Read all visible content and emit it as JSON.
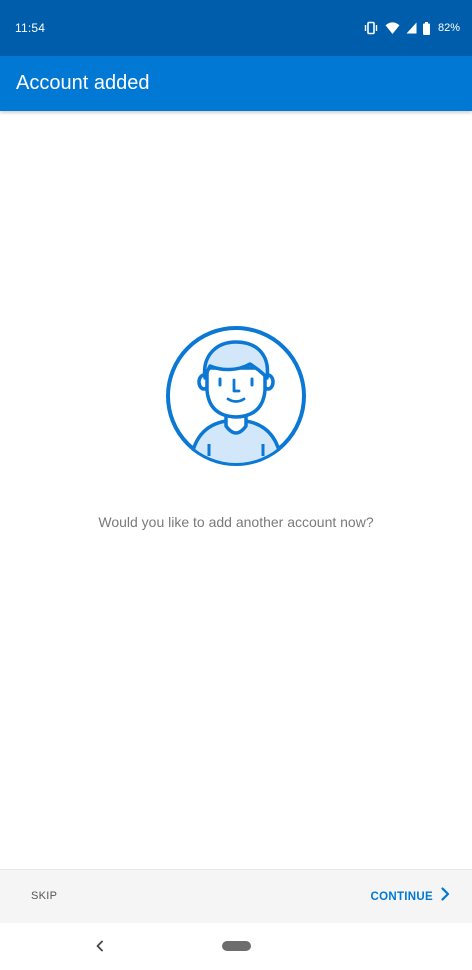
{
  "status_bar": {
    "time": "11:54",
    "battery": "82%",
    "icons": [
      "vibrate-icon",
      "wifi-icon",
      "signal-icon",
      "battery-icon"
    ]
  },
  "app_bar": {
    "title": "Account added"
  },
  "main": {
    "illustration": "avatar-illustration-icon",
    "prompt": "Would you like to add another account now?"
  },
  "actions": {
    "skip_label": "SKIP",
    "continue_label": "CONTINUE"
  },
  "nav": {
    "back_icon": "back-chevron-icon",
    "home_icon": "home-pill-icon"
  },
  "colors": {
    "status_bar": "#005DAB",
    "app_bar": "#0078D4",
    "accent": "#0078D4",
    "illustration_fill": "#D2E8FA"
  }
}
